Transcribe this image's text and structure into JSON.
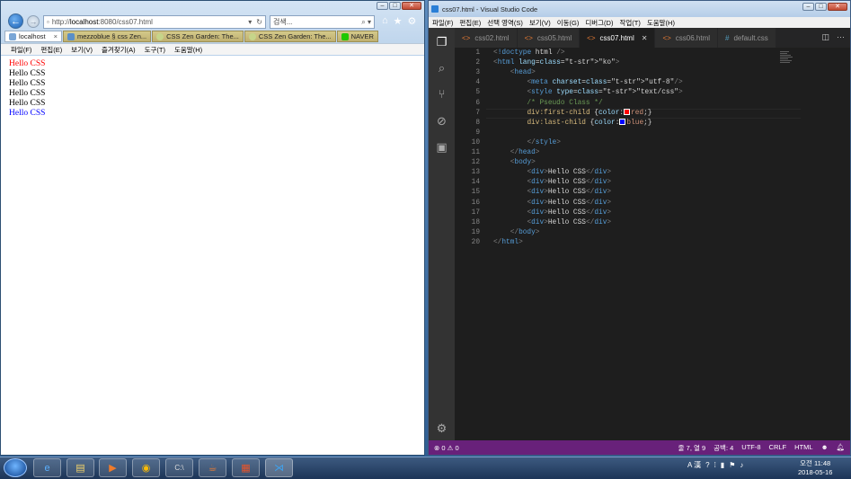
{
  "ie": {
    "url_prefix": "http://",
    "url_host": "localhost",
    "url_rest": ":8080/css07.html",
    "search_placeholder": "검색...",
    "tabs": [
      "localhost",
      "mezzoblue § css Zen...",
      "CSS Zen Garden: The...",
      "CSS Zen Garden: The...",
      "NAVER"
    ],
    "menu": [
      "파일(F)",
      "편집(E)",
      "보기(V)",
      "즐겨찾기(A)",
      "도구(T)",
      "도움말(H)"
    ],
    "page_lines": [
      "Hello CSS",
      "Hello CSS",
      "Hello CSS",
      "Hello CSS",
      "Hello CSS",
      "Hello CSS"
    ],
    "colors": {
      "first": "#ff0000",
      "last": "#0000ff"
    }
  },
  "vscode": {
    "title": "css07.html - Visual Studio Code",
    "menu": [
      "파일(F)",
      "편집(E)",
      "선택 영역(S)",
      "보기(V)",
      "이동(G)",
      "디버그(D)",
      "작업(T)",
      "도움말(H)"
    ],
    "tabs": [
      {
        "label": "css02.html",
        "icon": "<>",
        "active": false
      },
      {
        "label": "css05.html",
        "icon": "<>",
        "active": false
      },
      {
        "label": "css07.html",
        "icon": "<>",
        "active": true
      },
      {
        "label": "css06.html",
        "icon": "<>",
        "active": false
      },
      {
        "label": "default.css",
        "icon": "#",
        "active": false
      }
    ],
    "code_lines": [
      "<!doctype html />",
      "<html lang=\"ko\">",
      "    <head>",
      "        <meta charset=\"utf-8\"/>",
      "        <style type=\"text/css\">",
      "        /* Pseudo Class */",
      "        div:first-child {color:red;}",
      "        div:last-child {color:blue;}",
      "",
      "        </style>",
      "    </head>",
      "    <body>",
      "        <div>Hello CSS</div>",
      "        <div>Hello CSS</div>",
      "        <div>Hello CSS</div>",
      "        <div>Hello CSS</div>",
      "        <div>Hello CSS</div>",
      "        <div>Hello CSS</div>",
      "    </body>",
      "</html>"
    ],
    "status": {
      "errors": "0",
      "warnings": "0",
      "position": "줄 7, 열 9",
      "spaces": "공백: 4",
      "encoding": "UTF-8",
      "eol": "CRLF",
      "language": "HTML"
    },
    "accent": "#68217a"
  },
  "taskbar": {
    "time": "오전 11:48",
    "date": "2018-05-16"
  }
}
